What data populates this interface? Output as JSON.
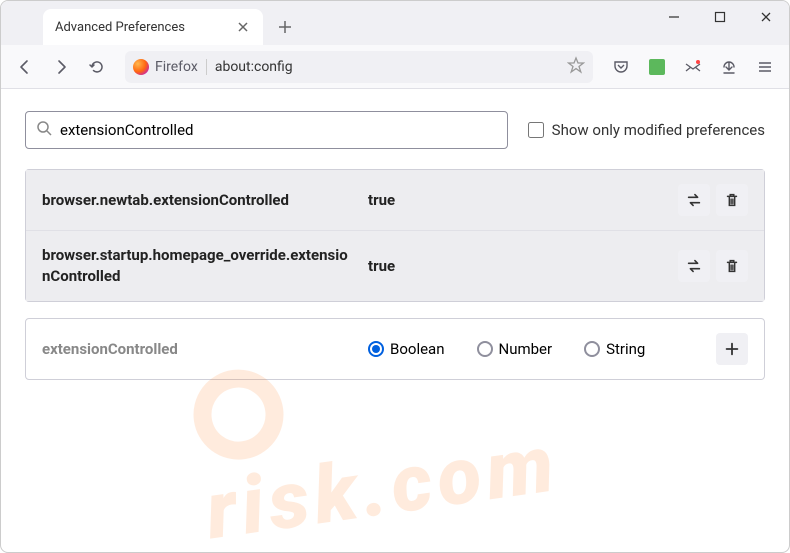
{
  "tab": {
    "title": "Advanced Preferences"
  },
  "urlbar": {
    "identity": "Firefox",
    "url": "about:config"
  },
  "search": {
    "value": "extensionControlled",
    "checkbox_label": "Show only modified preferences"
  },
  "prefs": [
    {
      "name": "browser.newtab.extensionControlled",
      "value": "true"
    },
    {
      "name": "browser.startup.homepage_override.extensionControlled",
      "value": "true"
    }
  ],
  "newpref": {
    "name": "extensionControlled",
    "types": [
      {
        "label": "Boolean",
        "checked": true
      },
      {
        "label": "Number",
        "checked": false
      },
      {
        "label": "String",
        "checked": false
      }
    ]
  }
}
